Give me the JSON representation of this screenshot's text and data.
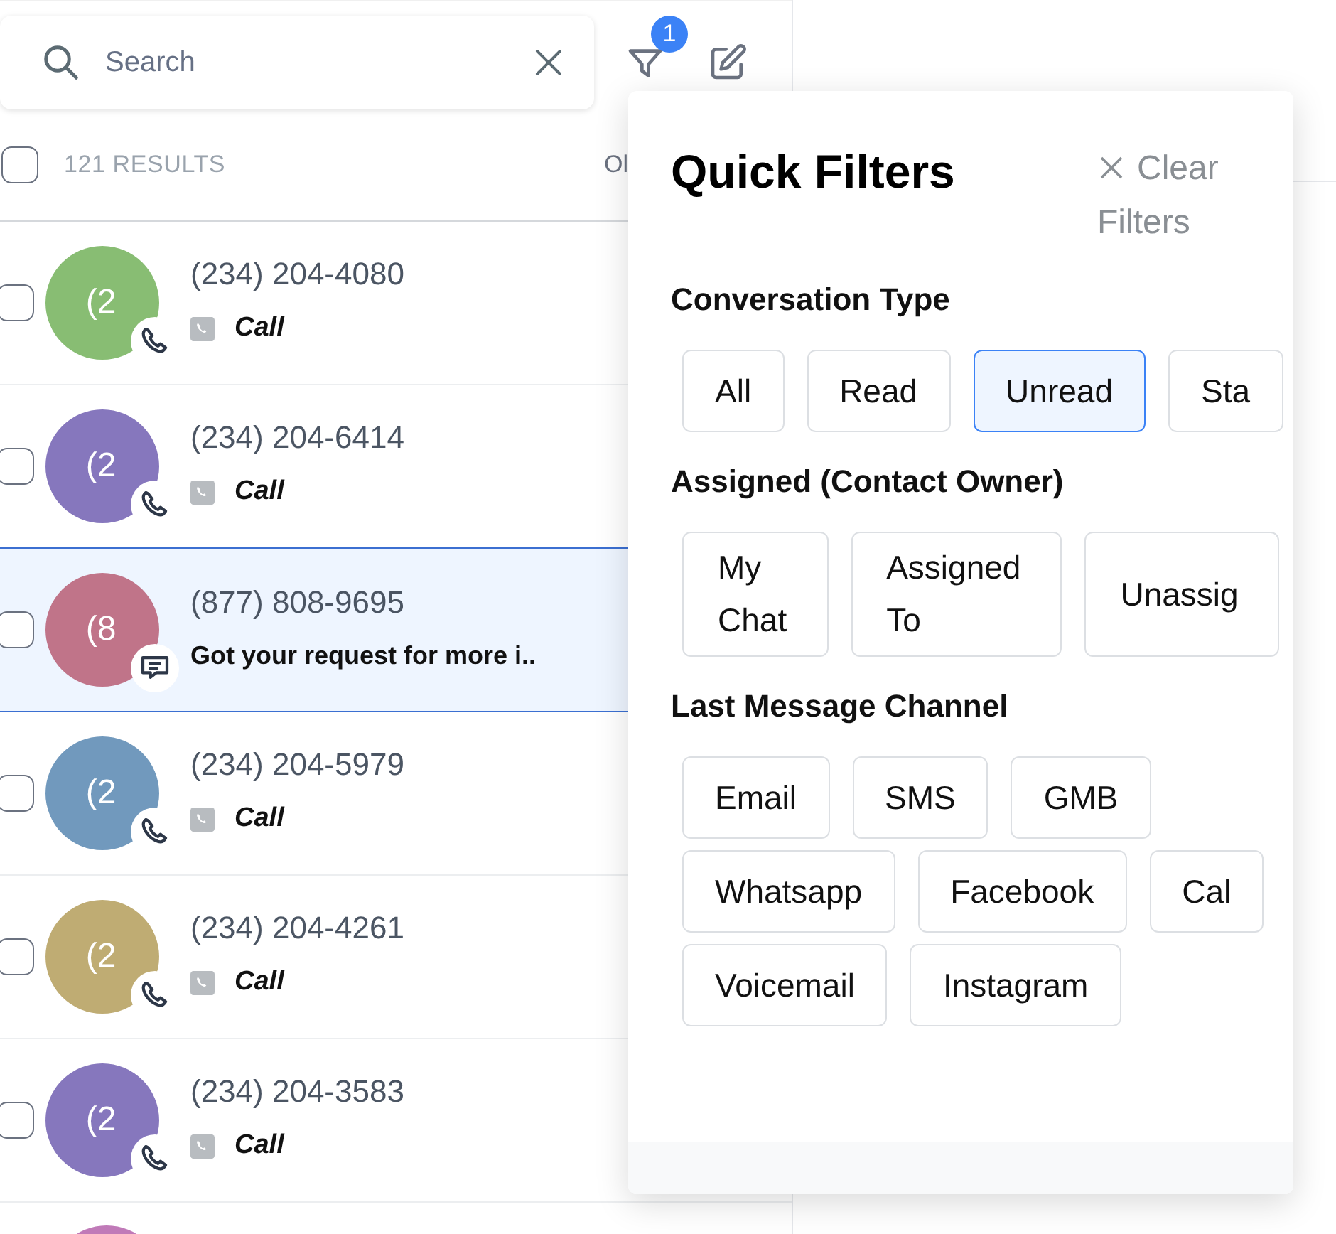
{
  "search": {
    "placeholder": "Search"
  },
  "filter_badge": "1",
  "results": {
    "label": "121 RESULTS",
    "checked": false,
    "sort_label": "Ol"
  },
  "conversations": [
    {
      "avatar": "(2",
      "color": "#88bd73",
      "phone": "(234) 204-4080",
      "kind": "call",
      "preview": "Call",
      "selected": false,
      "checked": false
    },
    {
      "avatar": "(2",
      "color": "#8677bd",
      "phone": "(234) 204-6414",
      "kind": "call",
      "preview": "Call",
      "selected": false,
      "checked": false
    },
    {
      "avatar": "(8",
      "color": "#c07489",
      "phone": "(877) 808-9695",
      "kind": "message",
      "preview": "Got your request for more i..",
      "selected": true,
      "checked": false
    },
    {
      "avatar": "(2",
      "color": "#7199bd",
      "phone": "(234) 204-5979",
      "kind": "call",
      "preview": "Call",
      "selected": false,
      "checked": false
    },
    {
      "avatar": "(2",
      "color": "#bfac73",
      "phone": "(234) 204-4261",
      "kind": "call",
      "preview": "Call",
      "selected": false,
      "checked": false
    },
    {
      "avatar": "(2",
      "color": "#8677bd",
      "phone": "(234) 204-3583",
      "kind": "call",
      "preview": "Call",
      "selected": false,
      "checked": false
    }
  ],
  "partial_row": {
    "color": "#c07ab8"
  },
  "quick_filters": {
    "title": "Quick Filters",
    "clear": "Clear Filters",
    "sections": [
      {
        "title": "Conversation Type",
        "chips": [
          {
            "label": "All",
            "selected": false
          },
          {
            "label": "Read",
            "selected": false
          },
          {
            "label": "Unread",
            "selected": true
          },
          {
            "label": "Sta",
            "selected": false
          }
        ]
      },
      {
        "title": "Assigned (Contact Owner)",
        "chips": [
          {
            "label": "My Chat",
            "selected": false
          },
          {
            "label": "Assigned To",
            "selected": false
          },
          {
            "label": "Unassig",
            "selected": false
          }
        ]
      },
      {
        "title": "Last Message Channel",
        "chips": [
          {
            "label": "Email",
            "selected": false
          },
          {
            "label": "SMS",
            "selected": false
          },
          {
            "label": "GMB",
            "selected": false
          },
          {
            "label": "Whatsapp",
            "selected": false
          },
          {
            "label": "Facebook",
            "selected": false
          },
          {
            "label": "Cal",
            "selected": false
          },
          {
            "label": "Voicemail",
            "selected": false
          },
          {
            "label": "Instagram",
            "selected": false
          }
        ]
      }
    ]
  }
}
